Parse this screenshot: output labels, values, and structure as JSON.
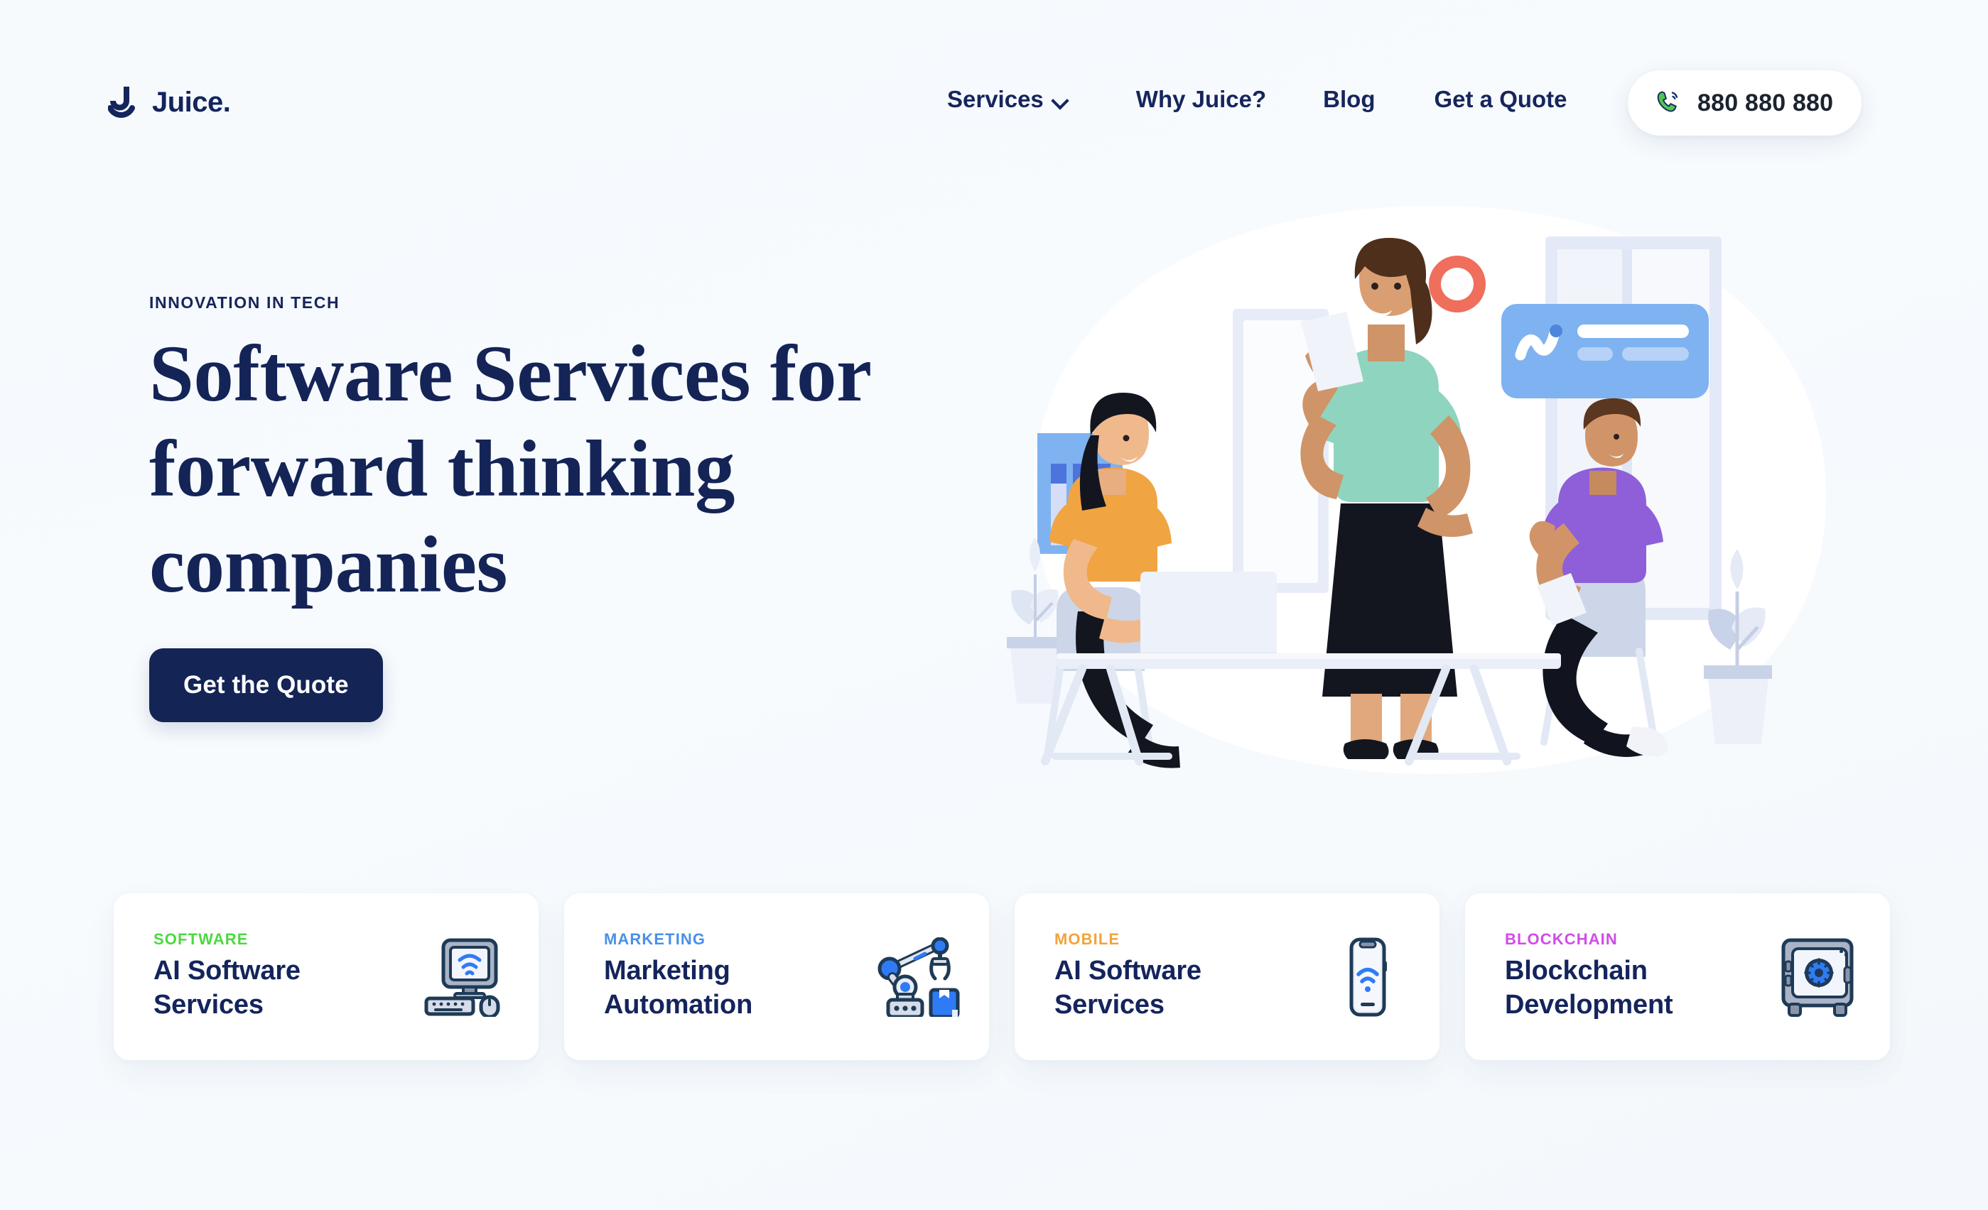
{
  "brand": {
    "name": "Juice.",
    "logo_icon": "juice-j-smile-logo"
  },
  "nav": {
    "items": [
      {
        "label": "Services",
        "has_dropdown": true,
        "icon": "chevron-down-icon"
      },
      {
        "label": "Why Juice?",
        "has_dropdown": false
      },
      {
        "label": "Blog",
        "has_dropdown": false
      },
      {
        "label": "Get a Quote",
        "has_dropdown": false
      }
    ],
    "phone": {
      "number": "880 880 880",
      "icon": "phone-call-icon",
      "icon_color": "#4FC84F"
    }
  },
  "hero": {
    "eyebrow": "INNOVATION IN TECH",
    "title": "Software Services for forward thinking companies",
    "cta_label": "Get the Quote",
    "illustration": "team-meeting-illustration",
    "illustration_elements": {
      "poster_icon": "bar-chart-poster",
      "reaction_icon": "heart-badge-icon",
      "card_icon": "analytics-chat-card",
      "plant_left_icon": "potted-plant-icon",
      "plant_right_icon": "potted-plant-icon",
      "laptop_icon": "laptop-icon"
    }
  },
  "cards": [
    {
      "tag": "SOFTWARE",
      "tag_color": "#4BD940",
      "title": "AI Software Services",
      "icon": "desktop-computer-wifi-icon"
    },
    {
      "tag": "MARKETING",
      "tag_color": "#4A90E8",
      "title": "Marketing Automation",
      "icon": "robot-arm-icon"
    },
    {
      "tag": "MOBILE",
      "tag_color": "#F2A33C",
      "title": "AI Software Services",
      "icon": "smartphone-wifi-icon"
    },
    {
      "tag": "BLOCKCHAIN",
      "tag_color": "#D14BE8",
      "title": "Blockchain Development",
      "icon": "safe-vault-icon"
    }
  ],
  "theme": {
    "background": "#f7fafd",
    "navy": "#14245c",
    "card_background": "#ffffff",
    "cta_background": "#132455"
  }
}
